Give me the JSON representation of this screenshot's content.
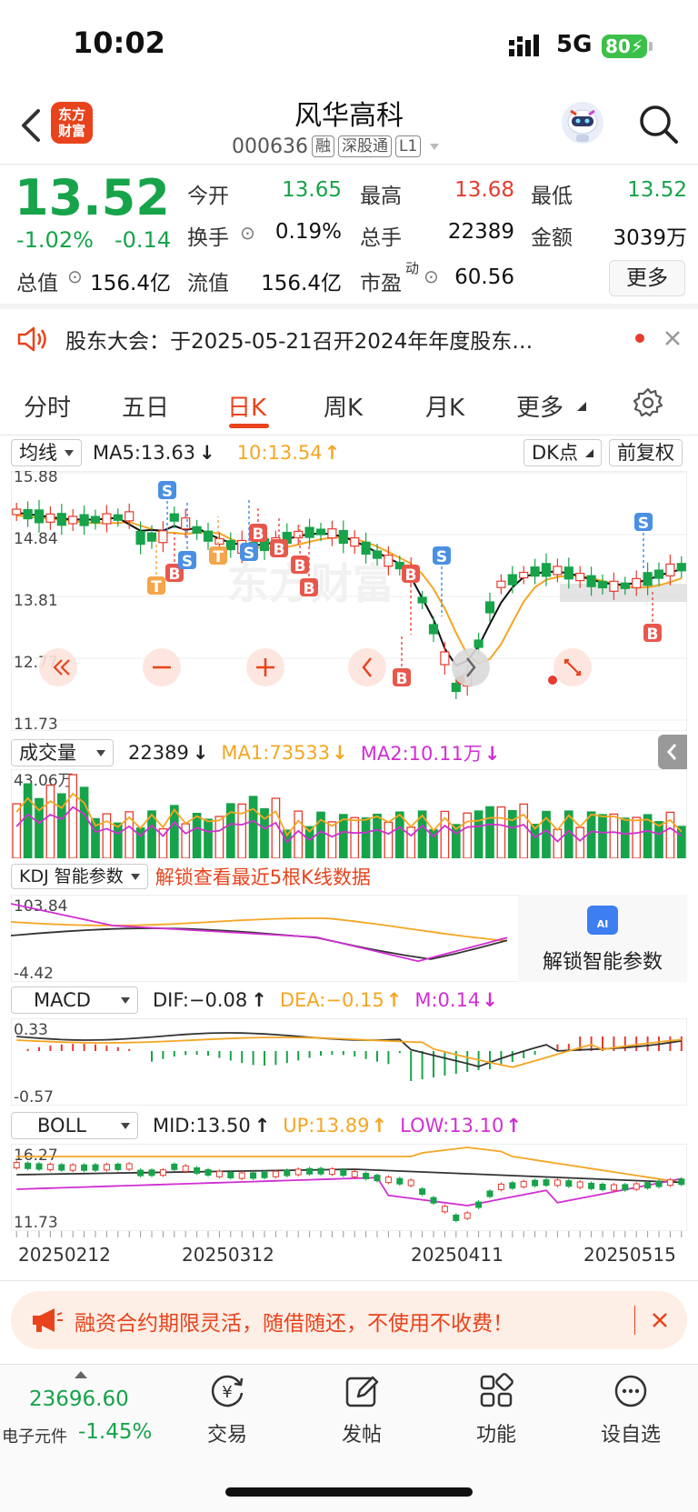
{
  "status": {
    "time": "10:02",
    "network": "5G",
    "battery": "80"
  },
  "header": {
    "logo_line1": "东方",
    "logo_line2": "财富",
    "stock_name": "风华高科",
    "stock_code": "000636",
    "tags": [
      "融",
      "深股通",
      "L1"
    ]
  },
  "quote": {
    "price": "13.52",
    "change_pct": "-1.02%",
    "change_amt": "-0.14",
    "rows": [
      [
        {
          "label": "今开",
          "value": "13.65",
          "color": "green"
        },
        {
          "label": "最高",
          "value": "13.68",
          "color": "red"
        },
        {
          "label": "最低",
          "value": "13.52",
          "color": "green"
        }
      ],
      [
        {
          "label": "换手",
          "value": "0.19%",
          "color": "dark"
        },
        {
          "label": "总手",
          "value": "22389",
          "color": "dark"
        },
        {
          "label": "金额",
          "value": "3039万",
          "color": "dark"
        }
      ]
    ],
    "zongzhi_label": "总值",
    "zongzhi_value": "156.4亿",
    "liuzhi_label": "流值",
    "liuzhi_value": "156.4亿",
    "shiying_label": "市盈",
    "shiying_sup": "动",
    "shiying_value": "60.56",
    "more_button": "更多"
  },
  "notice": {
    "text": "股东大会：于2025-05-21召开2024年年度股东…"
  },
  "tabs": {
    "items": [
      "分时",
      "五日",
      "日K",
      "周K",
      "月K",
      "更多"
    ],
    "active": 2
  },
  "kline": {
    "ma_selector": "均线",
    "ma5_text": "MA5:13.63",
    "ma10_text": "10:13.54",
    "dk_button": "DK点",
    "fuquan_button": "前复权",
    "price_ticks": [
      "15.88",
      "14.84",
      "13.81",
      "12.77",
      "11.73"
    ],
    "signal_labels": {
      "S": "S",
      "B": "B",
      "T": "T"
    }
  },
  "volume": {
    "selector": "成交量",
    "vol_text": "22389",
    "ma1_text": "MA1:73533",
    "ma2_text": "MA2:10.11万",
    "max_tick": "43.06万"
  },
  "kdj": {
    "selector": "KDJ 智能参数",
    "unlock_hint": "解锁查看最近5根K线数据",
    "top_tick": "103.84",
    "bottom_tick": "-4.42",
    "ai_badge": "AI",
    "unlock_button": "解锁智能参数"
  },
  "macd": {
    "selector": "MACD",
    "dif_text": "DIF:−0.08",
    "dea_text": "DEA:−0.15",
    "m_text": "M:0.14",
    "top_tick": "0.33",
    "bottom_tick": "-0.57"
  },
  "boll": {
    "selector": "BOLL",
    "mid_text": "MID:13.50",
    "up_text": "UP:13.89",
    "low_text": "LOW:13.10",
    "top_tick": "16.27",
    "bottom_tick": "11.73"
  },
  "dates": [
    "20250212",
    "20250312",
    "20250411",
    "20250515"
  ],
  "promo": {
    "text": "融资合约期限灵活，随借随还，不使用不收费！"
  },
  "bottom_nav": {
    "index_value": "23696.60",
    "index_name": "电子元件",
    "index_change": "-1.45%",
    "items": [
      "交易",
      "发帖",
      "功能",
      "设自选"
    ]
  },
  "colors": {
    "up": "#e63b2e",
    "down": "#17a34a",
    "accent": "#e8431c",
    "ma5": "#111111",
    "ma10": "#f5a623",
    "ma2": "#d12fd2"
  }
}
